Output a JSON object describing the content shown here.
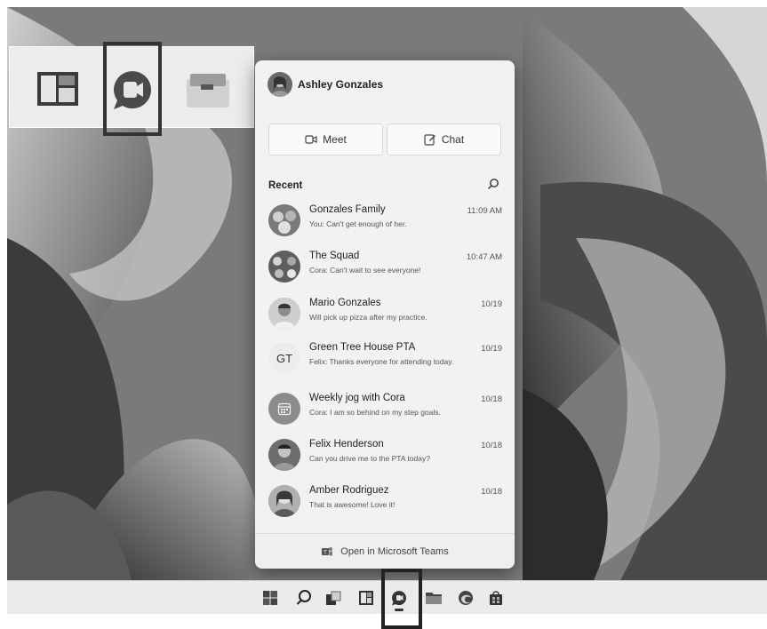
{
  "flyout": {
    "user_name": "Ashley Gonzales",
    "meet_label": "Meet",
    "chat_label": "Chat",
    "recent_label": "Recent",
    "footer_label": "Open in Microsoft Teams"
  },
  "chats": [
    {
      "name": "Gonzales Family",
      "preview": "You: Can't get enough of her.",
      "time": "11:09 AM",
      "avatar": "group-photo"
    },
    {
      "name": "The Squad",
      "preview": "Cora: Can't wait to see everyone!",
      "time": "10:47 AM",
      "avatar": "group-photo"
    },
    {
      "name": "Mario Gonzales",
      "preview": "Will pick up pizza after my practice.",
      "time": "10/19",
      "avatar": "person-photo"
    },
    {
      "name": "Green Tree House PTA",
      "preview": "Felix: Thanks everyone for attending today.",
      "time": "10/19",
      "avatar": "GT"
    },
    {
      "name": "Weekly jog with Cora",
      "preview": "Cora: I am so behind on my step goals.",
      "time": "10/18",
      "avatar": "calendar-icon"
    },
    {
      "name": "Felix Henderson",
      "preview": "Can you drive me to the PTA today?",
      "time": "10/18",
      "avatar": "person-photo"
    },
    {
      "name": "Amber Rodriguez",
      "preview": "That is awesome! Love it!",
      "time": "10/18",
      "avatar": "person-photo"
    }
  ],
  "taskbar": {
    "icons": [
      "start-icon",
      "search-icon",
      "task-view-icon",
      "widgets-icon",
      "chat-icon",
      "file-explorer-icon",
      "edge-icon",
      "store-icon"
    ]
  },
  "zoom_strip": {
    "icons": [
      "widgets-icon",
      "chat-icon",
      "task-view-icon"
    ]
  }
}
